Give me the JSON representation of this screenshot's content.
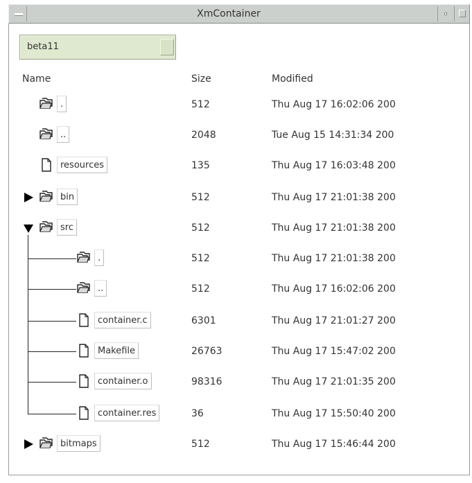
{
  "window": {
    "title": "XmContainer"
  },
  "path_selector": {
    "value": "beta11"
  },
  "columns": {
    "name": "Name",
    "size": "Size",
    "modified": "Modified"
  },
  "rows": [
    {
      "name": ".",
      "size": "512",
      "modified": "Thu Aug 17 16:02:06 200",
      "icon": "folder-icon",
      "expander": ""
    },
    {
      "name": "..",
      "size": "2048",
      "modified": "Tue Aug 15 14:31:34 200",
      "icon": "folder-icon",
      "expander": ""
    },
    {
      "name": "resources",
      "size": "135",
      "modified": "Thu Aug 17 16:03:48 200",
      "icon": "file-icon",
      "expander": ""
    },
    {
      "name": "bin",
      "size": "512",
      "modified": "Thu Aug 17 21:01:38 200",
      "icon": "folder-icon",
      "expander": "collapsed"
    },
    {
      "name": "src",
      "size": "512",
      "modified": "Thu Aug 17 21:01:38 200",
      "icon": "folder-icon",
      "expander": "expanded"
    },
    {
      "name": ".",
      "size": "512",
      "modified": "Thu Aug 17 21:01:38 200",
      "icon": "folder-icon",
      "expander": ""
    },
    {
      "name": "..",
      "size": "512",
      "modified": "Thu Aug 17 16:02:06 200",
      "icon": "folder-icon",
      "expander": ""
    },
    {
      "name": "container.c",
      "size": "6301",
      "modified": "Thu Aug 17 21:01:27 200",
      "icon": "file-icon",
      "expander": ""
    },
    {
      "name": "Makefile",
      "size": "26763",
      "modified": "Thu Aug 17 15:47:02 200",
      "icon": "file-icon",
      "expander": ""
    },
    {
      "name": "container.o",
      "size": "98316",
      "modified": "Thu Aug 17 21:01:35 200",
      "icon": "file-icon",
      "expander": ""
    },
    {
      "name": "container.res",
      "size": "36",
      "modified": "Thu Aug 17 15:50:40 200",
      "icon": "file-icon",
      "expander": ""
    },
    {
      "name": "bitmaps",
      "size": "512",
      "modified": "Thu Aug 17 15:46:44 200",
      "icon": "folder-icon",
      "expander": "collapsed"
    }
  ],
  "colors": {
    "title_bar": "#ccd0cc",
    "combo_background": "#dfe9cf",
    "tree_line": "#222222"
  }
}
